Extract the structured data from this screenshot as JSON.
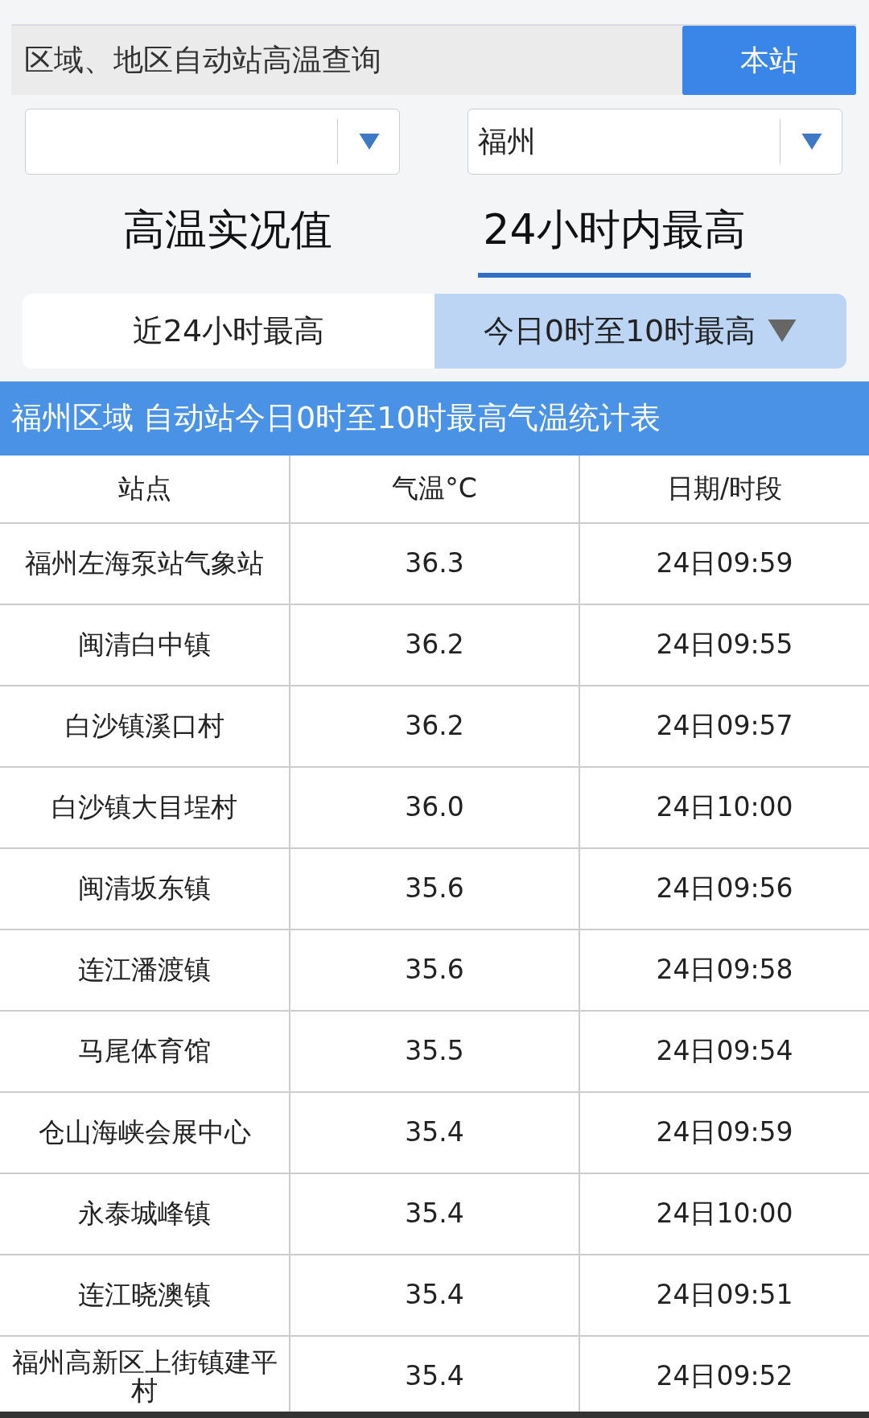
{
  "header": {
    "title": "区域、地区自动站高温查询",
    "button": "本站"
  },
  "selects": [
    {
      "kind": "empty"
    },
    {
      "kind": "filled",
      "value": "福州"
    }
  ],
  "tabs": [
    {
      "label": "高温实况值",
      "selected": false
    },
    {
      "label": "24小时内最高",
      "selected": true
    }
  ],
  "subtabs": [
    {
      "label": "近24小时最高",
      "selected": false
    },
    {
      "label": "今日0时至10时最高",
      "selected": true
    }
  ],
  "table_title": "福州区域 自动站今日0时至10时最高气温统计表",
  "table": {
    "columns": [
      "站点",
      "气温°C",
      "日期/时段"
    ],
    "rows": [
      [
        "福州左海泵站气象站",
        "36.3",
        "24日09:59"
      ],
      [
        "闽清白中镇",
        "36.2",
        "24日09:55"
      ],
      [
        "白沙镇溪口村",
        "36.2",
        "24日09:57"
      ],
      [
        "白沙镇大目埕村",
        "36.0",
        "24日10:00"
      ],
      [
        "闽清坂东镇",
        "35.6",
        "24日09:56"
      ],
      [
        "连江潘渡镇",
        "35.6",
        "24日09:58"
      ],
      [
        "马尾体育馆",
        "35.5",
        "24日09:54"
      ],
      [
        "仓山海峡会展中心",
        "35.4",
        "24日09:59"
      ],
      [
        "永泰城峰镇",
        "35.4",
        "24日10:00"
      ],
      [
        "连江晓澳镇",
        "35.4",
        "24日09:51"
      ],
      [
        "福州高新区上街镇建平村",
        "35.4",
        "24日09:52"
      ]
    ]
  }
}
